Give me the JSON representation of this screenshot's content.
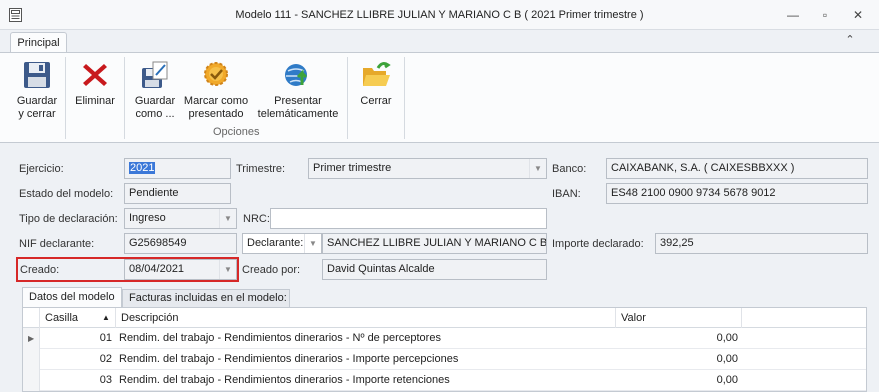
{
  "window": {
    "title": "Modelo 111 - SANCHEZ LLIBRE JULIAN Y MARIANO C B ( 2021 Primer trimestre )",
    "minimize": "—",
    "maximize": "▫",
    "close": "✕"
  },
  "ribbon_tabs": {
    "principal": "Principal",
    "collapse": "⌃"
  },
  "ribbon": {
    "guardar_cerrar": "Guardar\ny cerrar",
    "eliminar": "Eliminar",
    "guardar_como": "Guardar\ncomo ...",
    "marcar_presentado": "Marcar como\npresentado",
    "presentar": "Presentar\ntelemáticamente",
    "cerrar": "Cerrar",
    "group_opciones": "Opciones"
  },
  "form": {
    "ejercicio_label": "Ejercicio:",
    "ejercicio_value": "2021",
    "trimestre_label": "Trimestre:",
    "trimestre_value": "Primer trimestre",
    "banco_label": "Banco:",
    "banco_value": "CAIXABANK, S.A. ( CAIXESBBXXX )",
    "estado_label": "Estado del modelo:",
    "estado_value": "Pendiente",
    "iban_label": "IBAN:",
    "iban_value": "ES48 2100 0900 9734 5678 9012",
    "tipo_label": "Tipo de declaración:",
    "tipo_value": "Ingreso",
    "nrc_label": "NRC:",
    "nrc_value": "",
    "nif_label": "NIF declarante:",
    "nif_value": "G25698549",
    "declarante_button": "Declarante:",
    "declarante_name": "SANCHEZ LLIBRE JULIAN Y MARIANO C B",
    "importe_label": "Importe declarado:",
    "importe_value": "392,25",
    "creado_label": "Creado:",
    "creado_value": "08/04/2021",
    "creado_por_label": "Creado por:",
    "creado_por_value": "David Quintas Alcalde"
  },
  "detail_tabs": {
    "datos": "Datos del modelo",
    "facturas": "Facturas incluidas en el modelo:"
  },
  "grid": {
    "headers": {
      "casilla": "Casilla",
      "sort_arrow": "▲",
      "descripcion": "Descripción",
      "valor": "Valor"
    },
    "rows": [
      {
        "casilla": "01",
        "descripcion": "Rendim. del trabajo - Rendimientos dinerarios - Nº de perceptores",
        "valor": "0,00"
      },
      {
        "casilla": "02",
        "descripcion": "Rendim. del trabajo - Rendimientos dinerarios - Importe percepciones",
        "valor": "0,00"
      },
      {
        "casilla": "03",
        "descripcion": "Rendim. del trabajo - Rendimientos dinerarios - Importe retenciones",
        "valor": "0,00"
      }
    ]
  },
  "colors": {
    "highlight": "#d62828",
    "selection": "#3b78d8"
  }
}
